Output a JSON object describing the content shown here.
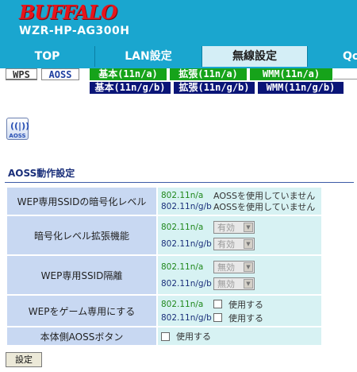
{
  "brand": {
    "logo": "BUFFALO",
    "model": "WZR-HP-AG300H"
  },
  "main_tabs": [
    {
      "label": "TOP"
    },
    {
      "label": "LAN設定"
    },
    {
      "label": "無線設定"
    },
    {
      "label": "Qo"
    }
  ],
  "sub_tabs": {
    "wps": "WPS",
    "aoss": "AOSS",
    "basic_a": "基本(11n/a)",
    "ext_a": "拡張(11n/a)",
    "wmm_a": "WMM(11n/a)",
    "basic_g": "基本(11n/g/b)",
    "ext_g": "拡張(11n/g/b)",
    "wmm_g": "WMM(11n/g/b)"
  },
  "icons": {
    "aoss": "aoss-icon",
    "aoss_text": "AOSS"
  },
  "section": {
    "title": "AOSS動作設定"
  },
  "rows": {
    "wep_level": {
      "label": "WEP専用SSIDの暗号化レベル",
      "a_std": "802.11n/a",
      "a_status": "AOSSを使用していません",
      "g_std": "802.11n/g/b",
      "g_status": "AOSSを使用していません"
    },
    "enc_ext": {
      "label": "暗号化レベル拡張機能",
      "a_std": "802.11n/a",
      "a_value": "有効",
      "g_std": "802.11n/g/b",
      "g_value": "有効"
    },
    "wep_isolation": {
      "label": "WEP専用SSID隔離",
      "a_std": "802.11n/a",
      "a_value": "無効",
      "g_std": "802.11n/g/b",
      "g_value": "無効"
    },
    "wep_game": {
      "label": "WEPをゲーム専用にする",
      "a_std": "802.11n/a",
      "a_check": "使用する",
      "g_std": "802.11n/g/b",
      "g_check": "使用する"
    },
    "aoss_button": {
      "label": "本体側AOSSボタン",
      "check": "使用する"
    }
  },
  "submit": {
    "label": "設定"
  },
  "colors": {
    "header": "#1aa6cf",
    "logo": "#e8141b",
    "tab_active": "#d4eef6",
    "subtab_green": "#16a31a",
    "subtab_navy": "#0a1577",
    "label_cell": "#c8d8f2",
    "value_cell": "#d7f2f3",
    "std_a": "#20881c",
    "std_g": "#1a2f7a"
  }
}
